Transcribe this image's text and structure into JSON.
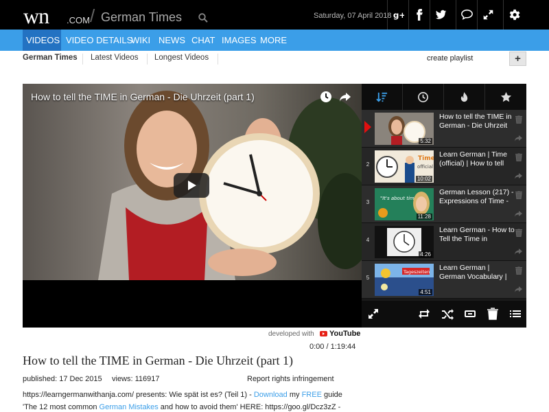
{
  "header": {
    "logo": "wn",
    "logo_suffix": ".COM",
    "slash": "/",
    "site_name": "German Times",
    "date": "Saturday, 07 April 2018",
    "icons": [
      "google-plus-icon",
      "facebook-icon",
      "twitter-icon",
      "chat-icon",
      "fullscreen-icon",
      "gear-icon"
    ]
  },
  "nav": {
    "items": [
      {
        "label": "VIDEOS"
      },
      {
        "label": "VIDEO DETAILS"
      },
      {
        "label": "WIKI"
      },
      {
        "label": "NEWS"
      },
      {
        "label": "CHAT"
      },
      {
        "label": "IMAGES"
      },
      {
        "label": "MORE"
      }
    ],
    "active": "VIDEOS"
  },
  "subtabs": {
    "items": [
      {
        "label": "German Times"
      },
      {
        "label": "Latest Videos"
      },
      {
        "label": "Longest Videos"
      }
    ],
    "create_playlist": "create playlist",
    "plus": "+"
  },
  "player": {
    "title": "How to tell the TIME in German - Die Uhrzeit (part 1)"
  },
  "playlist": {
    "tabs": [
      "sort-icon",
      "clock-icon",
      "flame-icon",
      "star-icon"
    ],
    "items": [
      {
        "num": "",
        "title": "How to tell the TIME in German - Die Uhrzeit",
        "duration": "5:32"
      },
      {
        "num": "2",
        "title": "Learn German | Time (official) | How to tell",
        "duration": "10:02"
      },
      {
        "num": "3",
        "title": "German Lesson (217) - Expressions of Time -",
        "duration": "11:28"
      },
      {
        "num": "4",
        "title": "Learn German - How to Tell the Time in",
        "duration": "4:26"
      },
      {
        "num": "5",
        "title": "Learn German | German Vocabulary |",
        "duration": "4:51"
      }
    ],
    "thumb_texts": {
      "time": "Time",
      "official": "official",
      "its_about": "\"It's about time!!\"",
      "tageszeiten": "Tageszeiten"
    },
    "controls": [
      "expand-icon",
      "repeat-icon",
      "shuffle-icon",
      "loop-icon",
      "trash-icon",
      "list-icon"
    ]
  },
  "below_player": {
    "developed_with": "developed with",
    "youtube": "YouTube",
    "time": "0:00 / 1:19:44"
  },
  "video": {
    "title": "How to tell the TIME in German - Die Uhrzeit (part 1)",
    "published": "published: 17 Dec 2015",
    "views": "views: 116917",
    "report": "Report rights infringement",
    "desc_line1_a": "https://learngermanwithanja.com/ presents: Wie spät ist es? (Teil 1) - ",
    "desc_line1_link1": "Download",
    "desc_line1_b": " my ",
    "desc_line1_link2": "FREE",
    "desc_line1_c": " guide",
    "desc_line2_a": "'The 12 most common ",
    "desc_line2_link": "German Mistakes",
    "desc_line2_b": " and how to avoid them' HERE: https://goo.gl/Dcz3zZ -"
  }
}
